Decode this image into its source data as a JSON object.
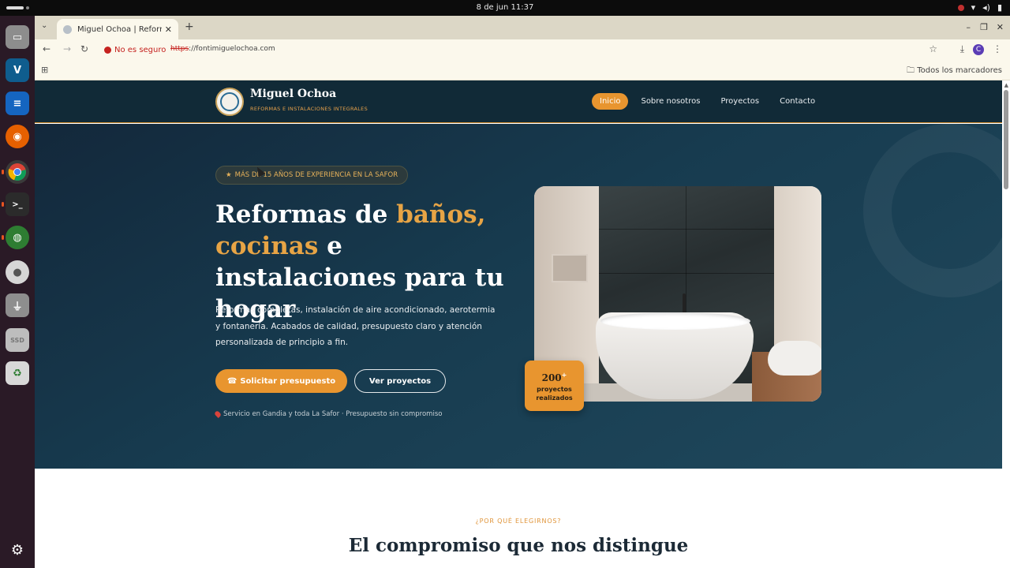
{
  "system": {
    "clock": "8 de jun  11:37"
  },
  "dock": {
    "items": [
      {
        "name": "files",
        "color": "#c74a3f",
        "glyph": "▭"
      },
      {
        "name": "vscode",
        "color": "#1f6fb5",
        "glyph": "V"
      },
      {
        "name": "writer",
        "color": "#1565c0",
        "glyph": "≡"
      },
      {
        "name": "firefox",
        "color": "#e66000",
        "glyph": "◉"
      },
      {
        "name": "chrome",
        "color": "#3d8f3d",
        "glyph": "◎"
      },
      {
        "name": "terminal",
        "color": "#2b2b2b",
        "glyph": ">_"
      },
      {
        "name": "browser2",
        "color": "#2e7d32",
        "glyph": "◍"
      },
      {
        "name": "disc",
        "color": "#d6d6d6",
        "glyph": "●"
      },
      {
        "name": "usb",
        "color": "#9e9e9e",
        "glyph": "⏚"
      },
      {
        "name": "ssd",
        "color": "#bdbdbd",
        "glyph": "SSD"
      },
      {
        "name": "trash",
        "color": "#d8d8d8",
        "glyph": "♻"
      },
      {
        "name": "apps",
        "color": "#2a1a26",
        "glyph": "⋯"
      }
    ]
  },
  "browser": {
    "tab_title": "Miguel Ochoa | Reforma",
    "not_secure": "No es seguro",
    "url_proto": "https",
    "url_rest": "://fontimiguelochoa.com",
    "bookmarks_all": "Todos los marcadores",
    "profile_initial": "C"
  },
  "site": {
    "brand_name": "Miguel Ochoa",
    "brand_tagline": "REFORMAS E INSTALACIONES INTEGRALES",
    "nav": [
      "Inicio",
      "Sobre nosotros",
      "Proyectos",
      "Contacto"
    ],
    "hero": {
      "badge": "MÁS DE 15 AÑOS DE EXPERIENCIA EN LA SAFOR",
      "headline_part1": "Reformas de ",
      "headline_accent1": "baños,",
      "headline_accent2": "cocinas",
      "headline_part2": " e instalaciones para tu hogar",
      "lead": "Reformas completas, instalación de aire acondicionado, aerotermia y fontanería. Acabados de calidad, presupuesto claro y atención personalizada de principio a fin.",
      "cta_primary": "Solicitar presupuesto",
      "cta_secondary": "Ver proyectos",
      "note": "Servicio en Gandia y toda La Safor · Presupuesto sin compromiso",
      "stat_number": "200",
      "stat_plus": "+",
      "stat_label": "proyectos realizados"
    },
    "section2": {
      "eyebrow": "¿POR QUÉ ELEGIRNOS?",
      "title": "El compromiso que nos distingue"
    }
  }
}
